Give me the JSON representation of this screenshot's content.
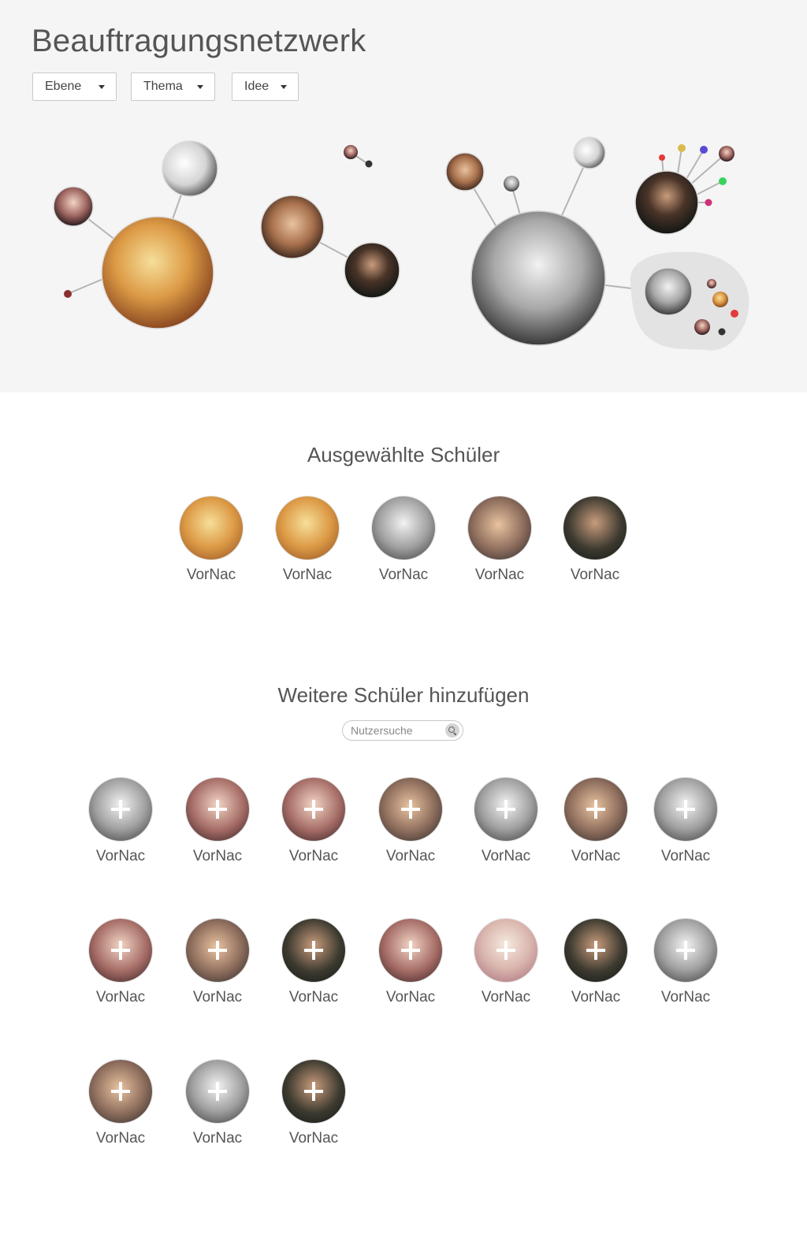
{
  "header": {
    "title": "Beauftragungsnetzwerk",
    "filters": [
      {
        "label": "Ebene"
      },
      {
        "label": "Thema"
      },
      {
        "label": "Idee"
      }
    ]
  },
  "colors": {
    "background_top": "#f5f5f5",
    "text": "#555555",
    "link_line": "#b5b5b5",
    "cluster_blob": "#e3e3e3"
  },
  "network": {
    "node_colors": [
      "#d8bb4d",
      "#5a4ad8",
      "#38d35e",
      "#d0307a",
      "#e23b3b",
      "#8a3030",
      "#333333"
    ]
  },
  "selected": {
    "heading": "Ausgewählte Schüler",
    "students": [
      {
        "name": "VorNac",
        "tone": "warm"
      },
      {
        "name": "VorNac",
        "tone": "warm"
      },
      {
        "name": "VorNac",
        "tone": "gray"
      },
      {
        "name": "VorNac",
        "tone": "mixed"
      },
      {
        "name": "VorNac",
        "tone": "dark"
      }
    ]
  },
  "add_more": {
    "heading": "Weitere Schüler hinzufügen",
    "search_placeholder": "Nutzersuche",
    "students": [
      {
        "name": "VorNac"
      },
      {
        "name": "VorNac"
      },
      {
        "name": "VorNac"
      },
      {
        "name": "VorNac"
      },
      {
        "name": "VorNac"
      },
      {
        "name": "VorNac"
      },
      {
        "name": "VorNac"
      },
      {
        "name": "VorNac"
      },
      {
        "name": "VorNac"
      },
      {
        "name": "VorNac"
      },
      {
        "name": "VorNac"
      },
      {
        "name": "VorNac"
      },
      {
        "name": "VorNac"
      },
      {
        "name": "VorNac"
      },
      {
        "name": "VorNac"
      },
      {
        "name": "VorNac"
      },
      {
        "name": "VorNac"
      }
    ]
  }
}
